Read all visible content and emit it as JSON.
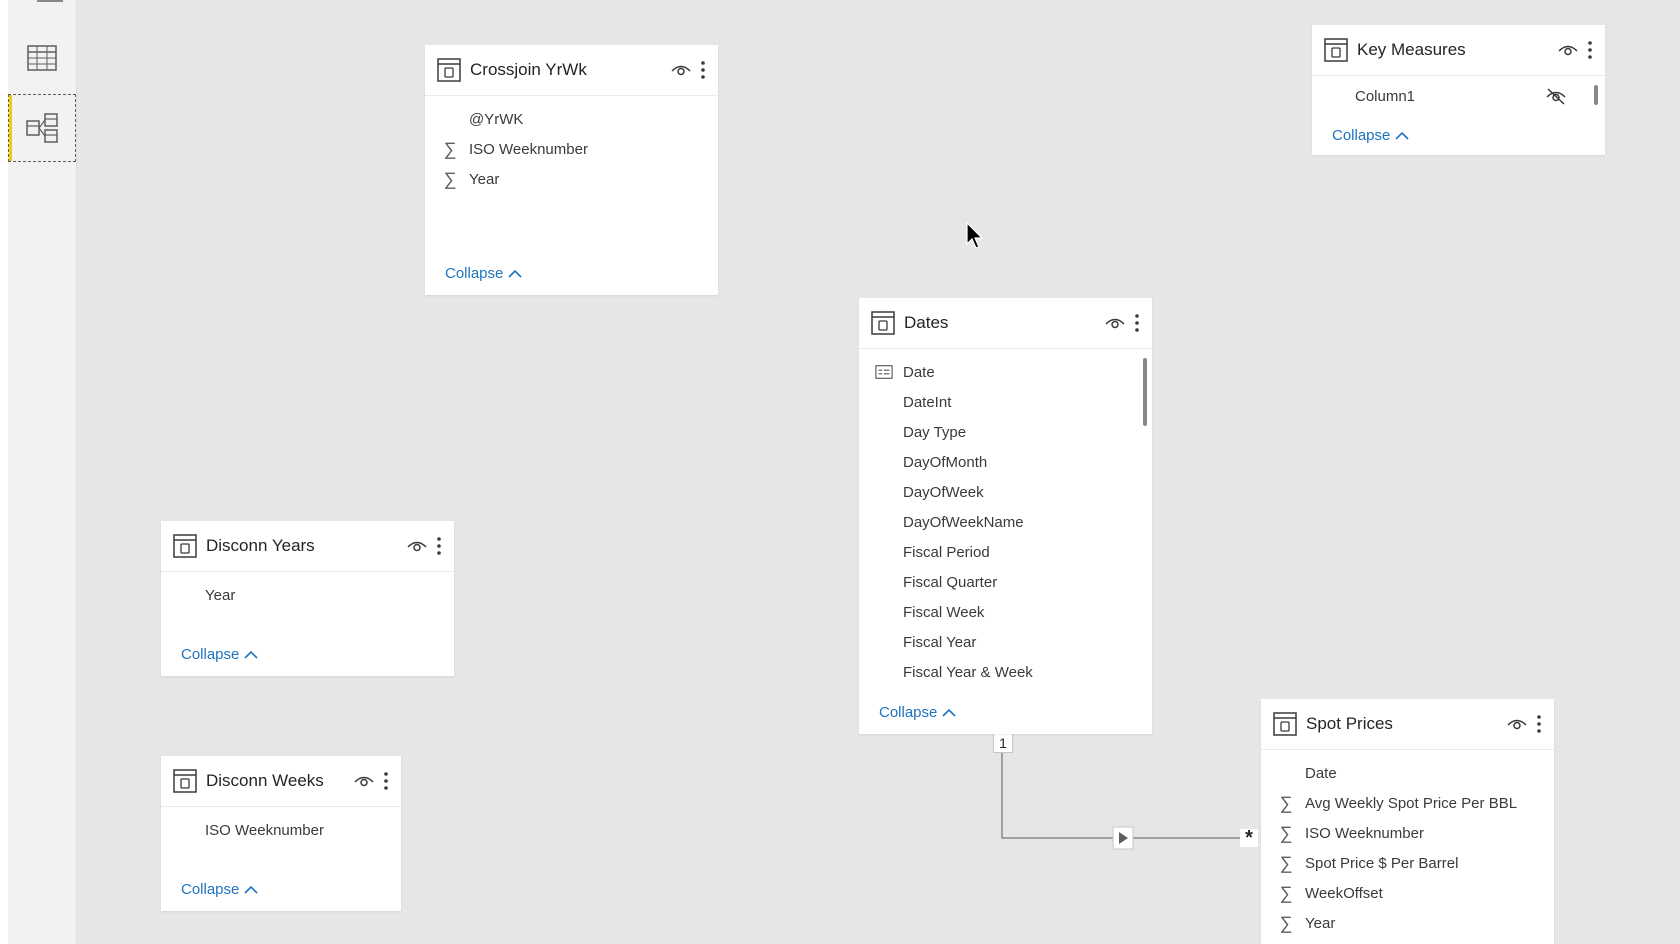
{
  "nav": {
    "items": [
      {
        "name": "Data view",
        "icon": "table-grid-icon"
      },
      {
        "name": "Model view",
        "icon": "model-view-icon",
        "active": true
      }
    ]
  },
  "tables": {
    "crossjoin": {
      "title": "Crossjoin YrWk",
      "fields": [
        {
          "name": "@YrWK",
          "icon": "none"
        },
        {
          "name": "ISO Weeknumber",
          "icon": "sigma"
        },
        {
          "name": "Year",
          "icon": "sigma"
        }
      ],
      "collapse_label": "Collapse"
    },
    "key_measures": {
      "title": "Key Measures",
      "fields": [
        {
          "name": "Column1",
          "icon": "none",
          "hidden": true
        }
      ],
      "collapse_label": "Collapse"
    },
    "dates": {
      "title": "Dates",
      "fields": [
        {
          "name": "Date",
          "icon": "date-key"
        },
        {
          "name": "DateInt",
          "icon": "none"
        },
        {
          "name": "Day Type",
          "icon": "none"
        },
        {
          "name": "DayOfMonth",
          "icon": "none"
        },
        {
          "name": "DayOfWeek",
          "icon": "none"
        },
        {
          "name": "DayOfWeekName",
          "icon": "none"
        },
        {
          "name": "Fiscal Period",
          "icon": "none"
        },
        {
          "name": "Fiscal Quarter",
          "icon": "none"
        },
        {
          "name": "Fiscal Week",
          "icon": "none"
        },
        {
          "name": "Fiscal Year",
          "icon": "none"
        },
        {
          "name": "Fiscal Year & Week",
          "icon": "none"
        }
      ],
      "collapse_label": "Collapse"
    },
    "disconn_years": {
      "title": "Disconn Years",
      "fields": [
        {
          "name": "Year",
          "icon": "none"
        }
      ],
      "collapse_label": "Collapse"
    },
    "disconn_weeks": {
      "title": "Disconn Weeks",
      "fields": [
        {
          "name": "ISO Weeknumber",
          "icon": "none"
        }
      ],
      "collapse_label": "Collapse"
    },
    "spot_prices": {
      "title": "Spot Prices",
      "fields": [
        {
          "name": "Date",
          "icon": "none"
        },
        {
          "name": "Avg Weekly Spot Price Per BBL",
          "icon": "sigma"
        },
        {
          "name": "ISO Weeknumber",
          "icon": "sigma"
        },
        {
          "name": "Spot Price $ Per Barrel",
          "icon": "sigma"
        },
        {
          "name": "WeekOffset",
          "icon": "sigma"
        },
        {
          "name": "Year",
          "icon": "sigma"
        }
      ]
    }
  },
  "relationship": {
    "from": "Dates",
    "to": "Spot Prices",
    "one_label": "1",
    "many_label": "*"
  },
  "colors": {
    "link": "#1f73bf",
    "canvas": "#e6e6e6",
    "active_accent": "#f2c811"
  }
}
